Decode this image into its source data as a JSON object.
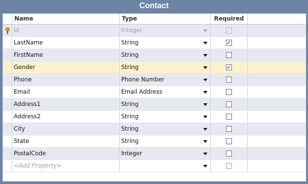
{
  "window": {
    "title": "Contact"
  },
  "columns": {
    "name": "Name",
    "type": "Type",
    "required": "Required"
  },
  "rows": [
    {
      "name": "Id",
      "type": "Integer",
      "required": true,
      "readonly": true,
      "key": true
    },
    {
      "name": "LastName",
      "type": "String",
      "required": true
    },
    {
      "name": "FirstName",
      "type": "String",
      "required": false
    },
    {
      "name": "Gender",
      "type": "String",
      "required": true,
      "selected": true
    },
    {
      "name": "Phone",
      "type": "Phone Number",
      "required": false
    },
    {
      "name": "Email",
      "type": "Email Address",
      "required": false
    },
    {
      "name": "Address1",
      "type": "String",
      "required": false
    },
    {
      "name": "Address2",
      "type": "String",
      "required": false
    },
    {
      "name": "City",
      "type": "String",
      "required": false
    },
    {
      "name": "State",
      "type": "String",
      "required": false
    },
    {
      "name": "PostalCode",
      "type": "Integer",
      "required": false
    }
  ],
  "add_row": {
    "placeholder": "<Add Property>",
    "type": ""
  },
  "colors": {
    "header_bg": "#6d84a4",
    "alt_row": "#e6e9f0",
    "selected_row": "#fdf1cd",
    "key_icon": "#e3a21a"
  }
}
